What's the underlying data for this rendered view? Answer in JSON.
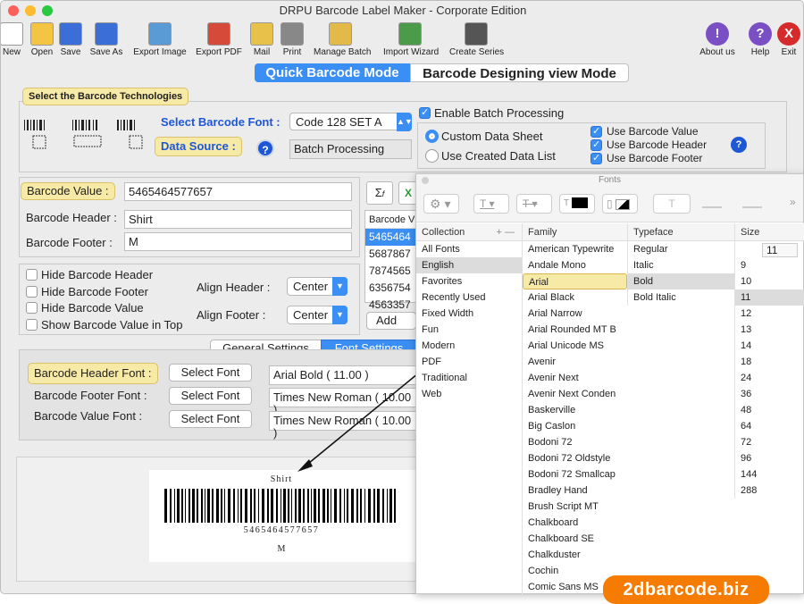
{
  "window": {
    "title": "DRPU Barcode Label Maker - Corporate Edition"
  },
  "toolbar": {
    "items": [
      {
        "label": "New",
        "icon": "new-document-icon"
      },
      {
        "label": "Open",
        "icon": "open-folder-icon"
      },
      {
        "label": "Save",
        "icon": "save-icon"
      },
      {
        "label": "Save As",
        "icon": "save-as-icon"
      },
      {
        "label": "Export Image",
        "icon": "export-image-icon"
      },
      {
        "label": "Export PDF",
        "icon": "export-pdf-icon"
      },
      {
        "label": "Mail",
        "icon": "mail-icon"
      },
      {
        "label": "Print",
        "icon": "printer-icon"
      },
      {
        "label": "Manage Batch",
        "icon": "manage-batch-icon"
      },
      {
        "label": "Import Wizard",
        "icon": "import-wizard-icon"
      },
      {
        "label": "Create Series",
        "icon": "create-series-icon"
      }
    ],
    "right": [
      {
        "label": "About us",
        "icon": "about-icon"
      },
      {
        "label": "Help",
        "icon": "help-icon"
      },
      {
        "label": "Exit",
        "icon": "exit-icon"
      }
    ]
  },
  "modes": {
    "quick": "Quick Barcode Mode",
    "design": "Barcode Designing view Mode"
  },
  "tech": {
    "title": "Select the Barcode Technologies",
    "font_label": "Select Barcode Font :",
    "font_value": "Code 128 SET A",
    "source_label": "Data Source :",
    "source_value": "Batch Processing"
  },
  "batch": {
    "enable": "Enable Batch Processing",
    "custom": "Custom Data Sheet",
    "created": "Use Created Data List",
    "use_value": "Use Barcode Value",
    "use_header": "Use Barcode Header",
    "use_footer": "Use Barcode Footer"
  },
  "fields": {
    "value_label": "Barcode Value :",
    "value": "5465464577657",
    "header_label": "Barcode Header :",
    "header": "Shirt",
    "footer_label": "Barcode Footer :",
    "footer": "M"
  },
  "options": {
    "hide_header": "Hide Barcode Header",
    "hide_footer": "Hide Barcode Footer",
    "hide_value": "Hide Barcode Value",
    "show_top": "Show Barcode Value in Top",
    "align_header": "Align Header :",
    "align_header_val": "Center",
    "align_footer": "Align Footer :",
    "align_footer_val": "Center"
  },
  "list": {
    "header": "Barcode V",
    "rows": [
      "5465464",
      "5687867",
      "7874565",
      "6356754",
      "4563357"
    ],
    "add": "Add"
  },
  "tabs": {
    "general": "General Settings",
    "font": "Font Settings"
  },
  "fontset": {
    "header_label": "Barcode Header Font :",
    "footer_label": "Barcode Footer Font :",
    "value_label": "Barcode Value Font :",
    "select": "Select Font",
    "header_font": "Arial Bold ( 11.00 )",
    "footer_font": "Times New Roman ( 10.00 )",
    "value_font": "Times New Roman ( 10.00 )"
  },
  "preview": {
    "header": "Shirt",
    "value": "5465464577657",
    "footer": "M"
  },
  "fonts_panel": {
    "title": "Fonts",
    "collection_header": "Collection",
    "family_header": "Family",
    "typeface_header": "Typeface",
    "size_header": "Size",
    "size_value": "11",
    "collections": [
      "All Fonts",
      "English",
      "Favorites",
      "Recently Used",
      "Fixed Width",
      "Fun",
      "Modern",
      "PDF",
      "Traditional",
      "Web"
    ],
    "families": [
      "American Typewrite",
      "Andale Mono",
      "Arial",
      "Arial Black",
      "Arial Narrow",
      "Arial Rounded MT B",
      "Arial Unicode MS",
      "Avenir",
      "Avenir Next",
      "Avenir Next Conden",
      "Baskerville",
      "Big Caslon",
      "Bodoni 72",
      "Bodoni 72 Oldstyle",
      "Bodoni 72 Smallcap",
      "Bradley Hand",
      "Brush Script MT",
      "Chalkboard",
      "Chalkboard SE",
      "Chalkduster",
      "Cochin",
      "Comic Sans MS"
    ],
    "typefaces": [
      "Regular",
      "Italic",
      "Bold",
      "Bold Italic"
    ],
    "sizes": [
      "9",
      "10",
      "11",
      "12",
      "13",
      "14",
      "18",
      "24",
      "36",
      "48",
      "64",
      "72",
      "96",
      "144",
      "288"
    ]
  },
  "watermark": "2dbarcode.biz"
}
